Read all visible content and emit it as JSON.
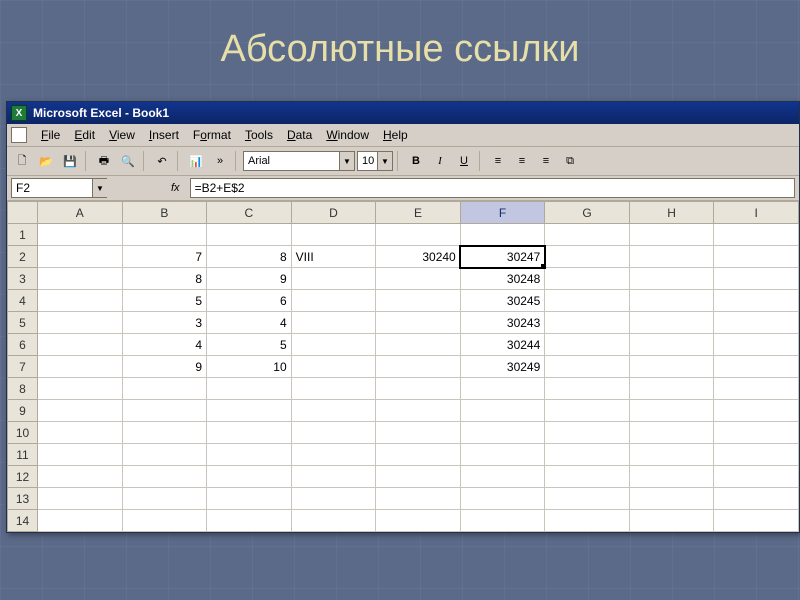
{
  "slide": {
    "title": "Абсолютные ссылки"
  },
  "titlebar": {
    "app_icon_text": "X",
    "title": "Microsoft Excel - Book1"
  },
  "menu": {
    "items": [
      {
        "pre": "",
        "u": "F",
        "post": "ile"
      },
      {
        "pre": "",
        "u": "E",
        "post": "dit"
      },
      {
        "pre": "",
        "u": "V",
        "post": "iew"
      },
      {
        "pre": "",
        "u": "I",
        "post": "nsert"
      },
      {
        "pre": "F",
        "u": "o",
        "post": "rmat"
      },
      {
        "pre": "",
        "u": "T",
        "post": "ools"
      },
      {
        "pre": "",
        "u": "D",
        "post": "ata"
      },
      {
        "pre": "",
        "u": "W",
        "post": "indow"
      },
      {
        "pre": "",
        "u": "H",
        "post": "elp"
      }
    ]
  },
  "toolbar": {
    "font_name": "Arial",
    "font_size": "10",
    "dropdown_glyph": "▼",
    "expand_glyph": "»",
    "icons": {
      "new": "🗋",
      "open": "📂",
      "save": "💾",
      "print": "🖶",
      "preview": "🔍",
      "undo": "↶",
      "chart": "📊",
      "bold": "B",
      "italic": "I",
      "underline": "U",
      "align_left": "≡",
      "align_center": "≡",
      "align_right": "≡",
      "merge": "⧉"
    }
  },
  "formula_bar": {
    "name_box": "F2",
    "fx_label": "fx",
    "formula": "=B2+E$2"
  },
  "grid": {
    "columns": [
      "A",
      "B",
      "C",
      "D",
      "E",
      "F",
      "G",
      "H",
      "I"
    ],
    "active_col": "F",
    "active_cell": "F2",
    "rows": [
      {
        "n": "1",
        "cells": [
          "",
          "",
          "",
          "",
          "",
          "",
          "",
          "",
          ""
        ]
      },
      {
        "n": "2",
        "cells": [
          "",
          "7",
          "8",
          "VIII",
          "30240",
          "30247",
          "",
          "",
          ""
        ]
      },
      {
        "n": "3",
        "cells": [
          "",
          "8",
          "9",
          "",
          "",
          "30248",
          "",
          "",
          ""
        ]
      },
      {
        "n": "4",
        "cells": [
          "",
          "5",
          "6",
          "",
          "",
          "30245",
          "",
          "",
          ""
        ]
      },
      {
        "n": "5",
        "cells": [
          "",
          "3",
          "4",
          "",
          "",
          "30243",
          "",
          "",
          ""
        ]
      },
      {
        "n": "6",
        "cells": [
          "",
          "4",
          "5",
          "",
          "",
          "30244",
          "",
          "",
          ""
        ]
      },
      {
        "n": "7",
        "cells": [
          "",
          "9",
          "10",
          "",
          "",
          "30249",
          "",
          "",
          ""
        ]
      },
      {
        "n": "8",
        "cells": [
          "",
          "",
          "",
          "",
          "",
          "",
          "",
          "",
          ""
        ]
      },
      {
        "n": "9",
        "cells": [
          "",
          "",
          "",
          "",
          "",
          "",
          "",
          "",
          ""
        ]
      },
      {
        "n": "10",
        "cells": [
          "",
          "",
          "",
          "",
          "",
          "",
          "",
          "",
          ""
        ]
      },
      {
        "n": "11",
        "cells": [
          "",
          "",
          "",
          "",
          "",
          "",
          "",
          "",
          ""
        ]
      },
      {
        "n": "12",
        "cells": [
          "",
          "",
          "",
          "",
          "",
          "",
          "",
          "",
          ""
        ]
      },
      {
        "n": "13",
        "cells": [
          "",
          "",
          "",
          "",
          "",
          "",
          "",
          "",
          ""
        ]
      },
      {
        "n": "14",
        "cells": [
          "",
          "",
          "",
          "",
          "",
          "",
          "",
          "",
          ""
        ]
      }
    ]
  },
  "chart_data": {
    "type": "table",
    "title": "Абсолютные ссылки",
    "columns": [
      "B",
      "C",
      "D",
      "E",
      "F"
    ],
    "rows": [
      {
        "row": 2,
        "B": 7,
        "C": 8,
        "D": "VIII",
        "E": 30240,
        "F": 30247
      },
      {
        "row": 3,
        "B": 8,
        "C": 9,
        "D": "",
        "E": "",
        "F": 30248
      },
      {
        "row": 4,
        "B": 5,
        "C": 6,
        "D": "",
        "E": "",
        "F": 30245
      },
      {
        "row": 5,
        "B": 3,
        "C": 4,
        "D": "",
        "E": "",
        "F": 30243
      },
      {
        "row": 6,
        "B": 4,
        "C": 5,
        "D": "",
        "E": "",
        "F": 30244
      },
      {
        "row": 7,
        "B": 9,
        "C": 10,
        "D": "",
        "E": "",
        "F": 30249
      }
    ],
    "formula_sample": "=B2+E$2"
  }
}
